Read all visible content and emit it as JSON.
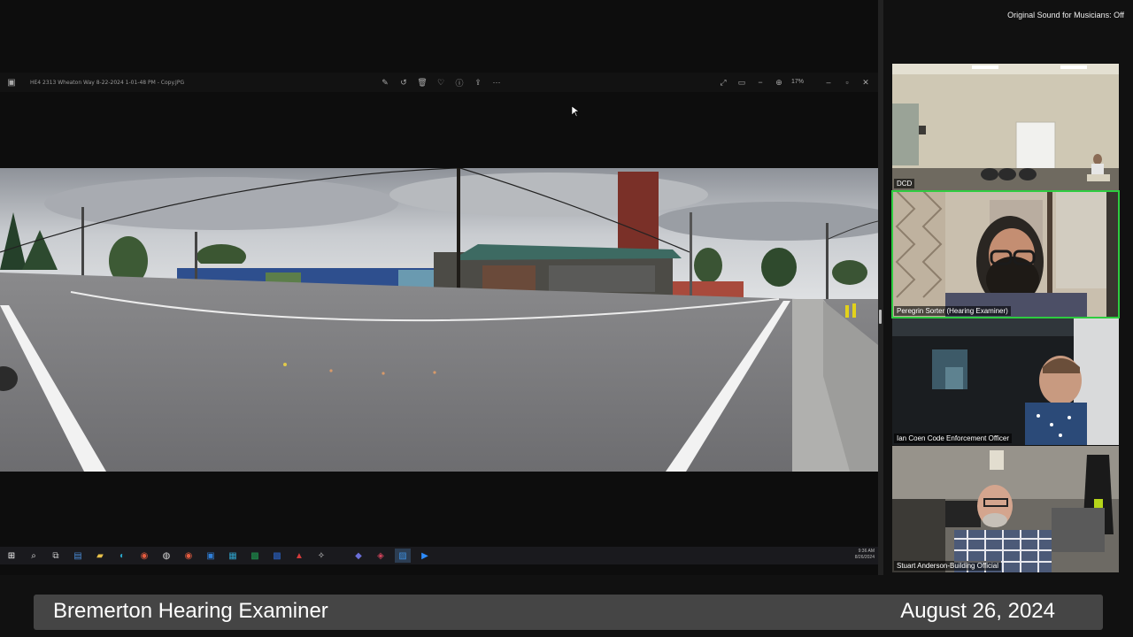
{
  "audio_status": "Original Sound for Musicians: Off",
  "viewer": {
    "file_name": "HE4 2313 Wheaton Way 8-22-2024 1-01-48 PM - Copy.JPG",
    "zoom": "17%",
    "toolbar_icons": [
      "edit-icon",
      "rotate-icon",
      "delete-icon",
      "favorite-icon",
      "info-icon",
      "share-icon",
      "more-icon"
    ],
    "window_icons": [
      "expand-icon",
      "slideshow-icon",
      "zoom-out-icon",
      "zoom-in-icon"
    ]
  },
  "taskbar": {
    "time": "9:36 AM",
    "date": "8/26/2024",
    "apps": [
      "start-icon",
      "search-icon",
      "task-view-icon",
      "file-app-icon",
      "folder-icon",
      "edge-icon",
      "chrome-icon",
      "app-icon",
      "chrome-alt-icon",
      "outlook-icon",
      "calendar-icon",
      "excel-icon",
      "word-icon",
      "acrobat-icon",
      "app-icon",
      "teams-icon",
      "app-icon",
      "photos-icon",
      "zoom-icon"
    ]
  },
  "participants": [
    {
      "name": "DCD",
      "active": false
    },
    {
      "name": "Peregrin Sorter (Hearing Examiner)",
      "active": true
    },
    {
      "name": "Ian Coen Code Enforcement Officer",
      "active": false
    },
    {
      "name": "Stuart Anderson-Building Official",
      "active": false
    }
  ],
  "banner": {
    "title": "Bremerton Hearing Examiner",
    "date": "August 26, 2024"
  },
  "colors": {
    "active_speaker": "#2ecc40",
    "banner_bg": "#454545"
  }
}
